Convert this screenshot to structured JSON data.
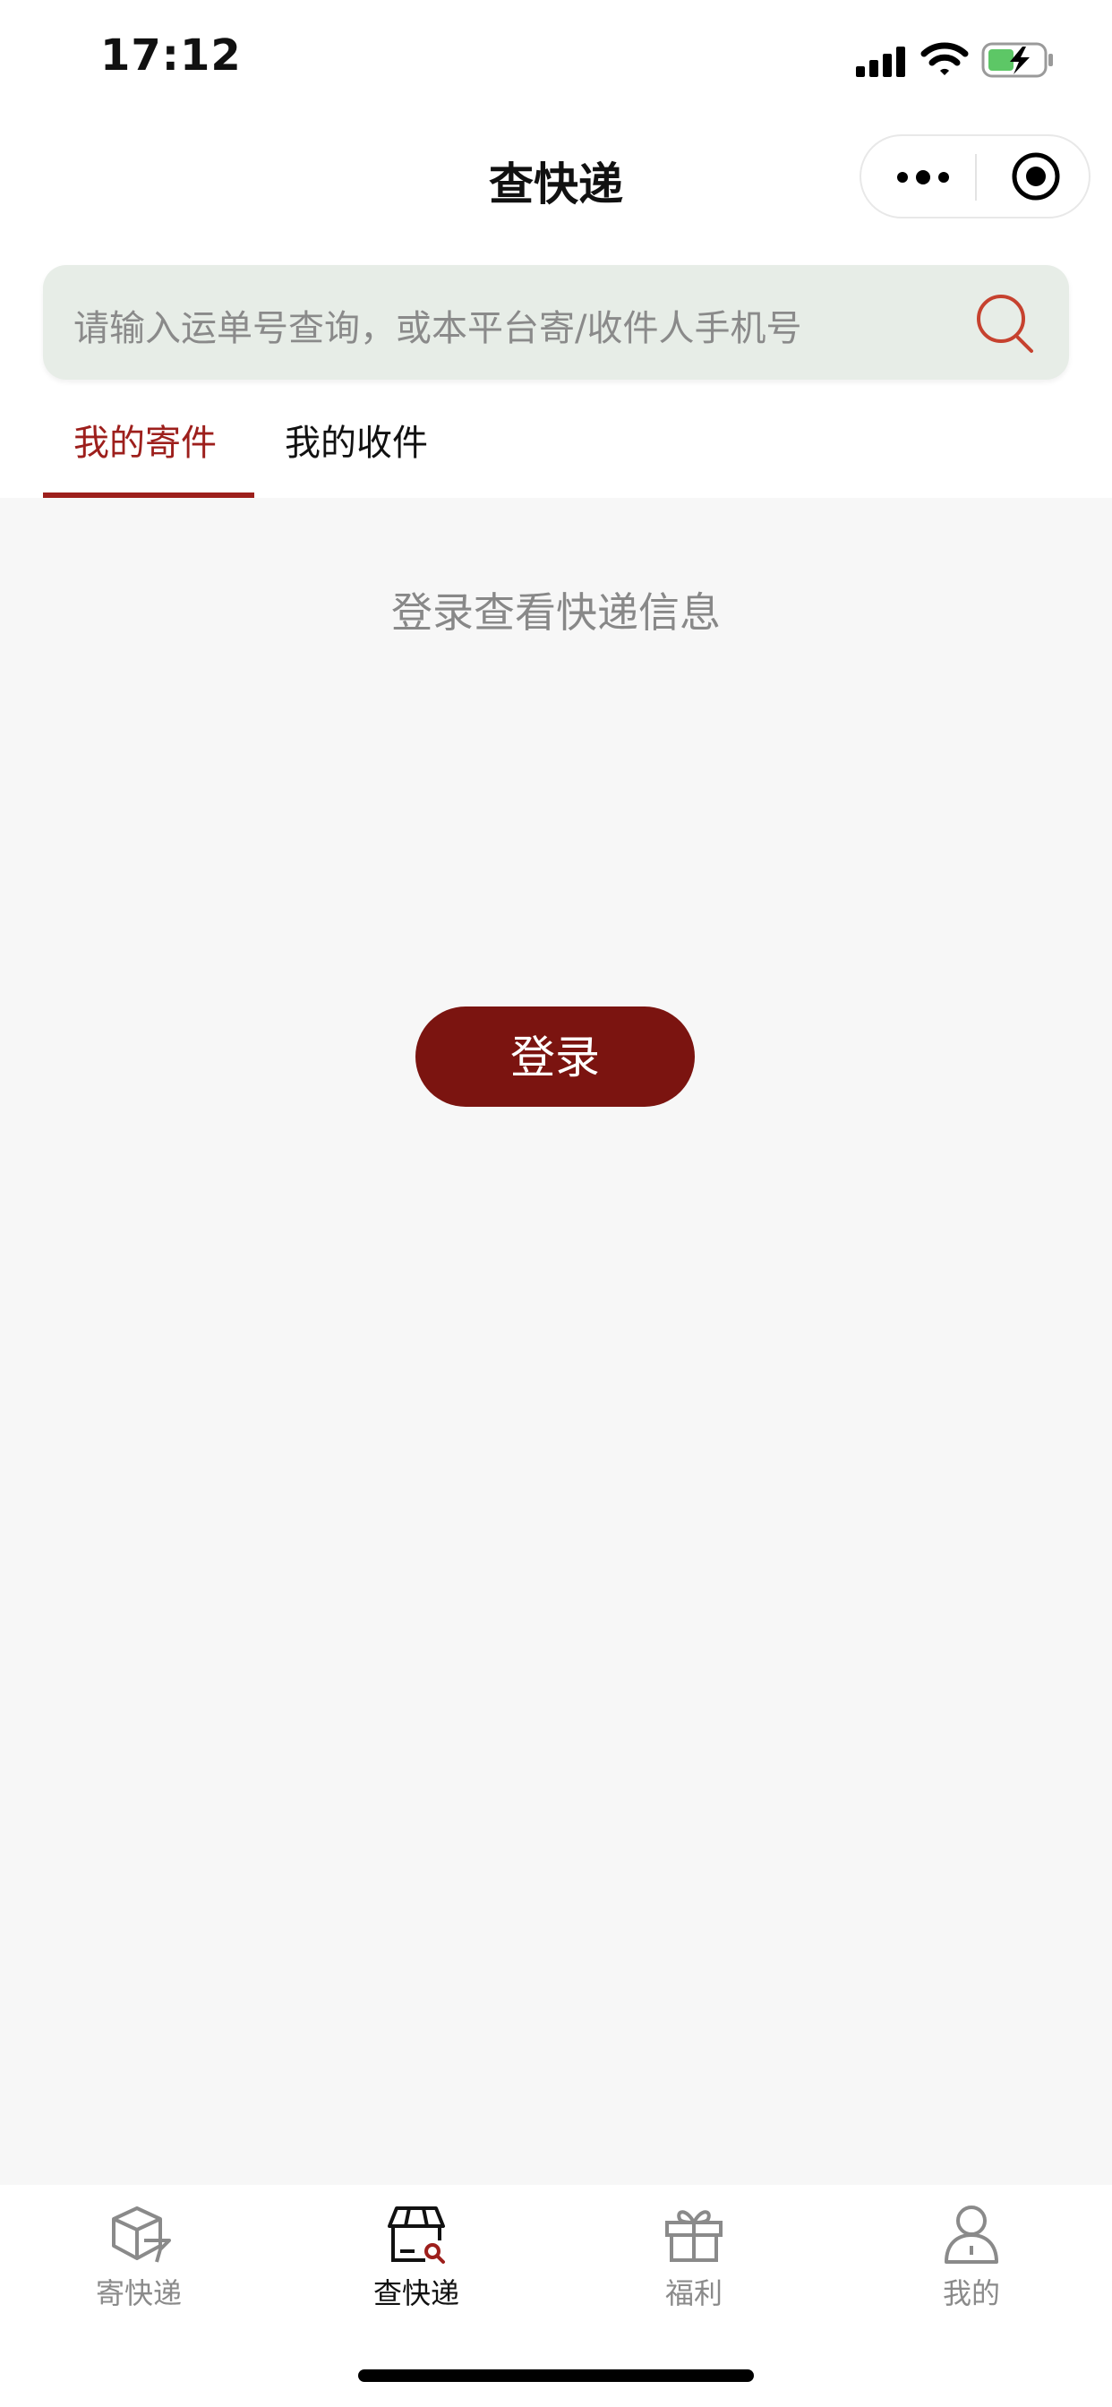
{
  "status_bar": {
    "time": "17:12"
  },
  "nav": {
    "title": "查快递",
    "more_icon": "more-icon",
    "close_icon": "miniprogram-close-icon"
  },
  "search": {
    "placeholder": "请输入运单号查询，或本平台寄/收件人手机号",
    "icon": "search-icon"
  },
  "tabs": [
    {
      "label": "我的寄件",
      "active": true
    },
    {
      "label": "我的收件",
      "active": false
    }
  ],
  "main": {
    "hint": "登录查看快递信息",
    "login_label": "登录"
  },
  "tabbar": {
    "items": [
      {
        "label": "寄快递",
        "icon": "send-package-icon",
        "active": false
      },
      {
        "label": "查快递",
        "icon": "track-package-icon",
        "active": true
      },
      {
        "label": "福利",
        "icon": "gift-icon",
        "active": false
      },
      {
        "label": "我的",
        "icon": "user-icon",
        "active": false
      }
    ]
  },
  "colors": {
    "accent": "#9d1f1c",
    "button": "#7b1410",
    "search_bg": "#e7ede7",
    "page_bg": "#f7f7f7",
    "battery_fill": "#5dc766"
  }
}
